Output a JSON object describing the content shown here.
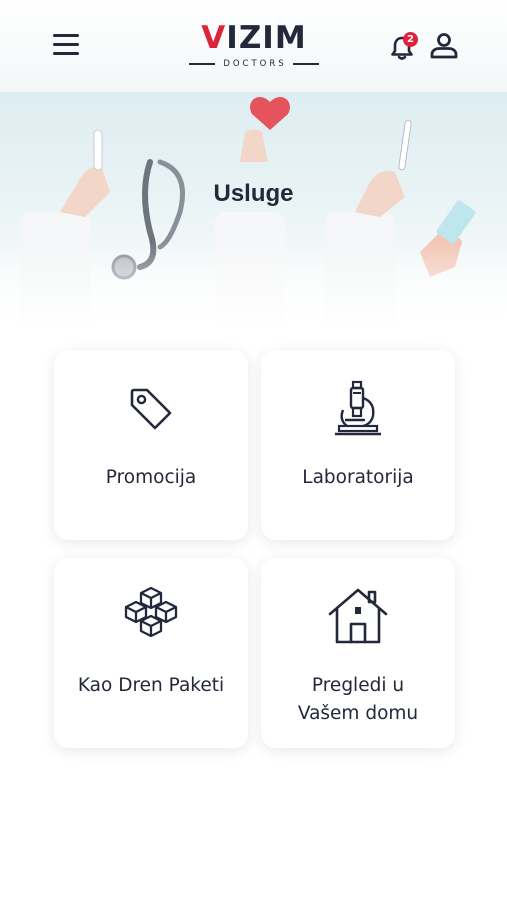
{
  "header": {
    "logo_main": "VIZIM",
    "logo_sub": "DOCTORS",
    "notification_count": "2",
    "brand_color": "#e0233c"
  },
  "hero": {
    "title": "Usluge"
  },
  "services": [
    {
      "label": "Promocija",
      "icon": "tag-icon"
    },
    {
      "label": "Laboratorija",
      "icon": "microscope-icon"
    },
    {
      "label": "Kao Dren Paketi",
      "icon": "boxes-icon"
    },
    {
      "label_line1": "Pregledi u",
      "label_line2": "Vašem domu",
      "icon": "home-icon"
    }
  ]
}
